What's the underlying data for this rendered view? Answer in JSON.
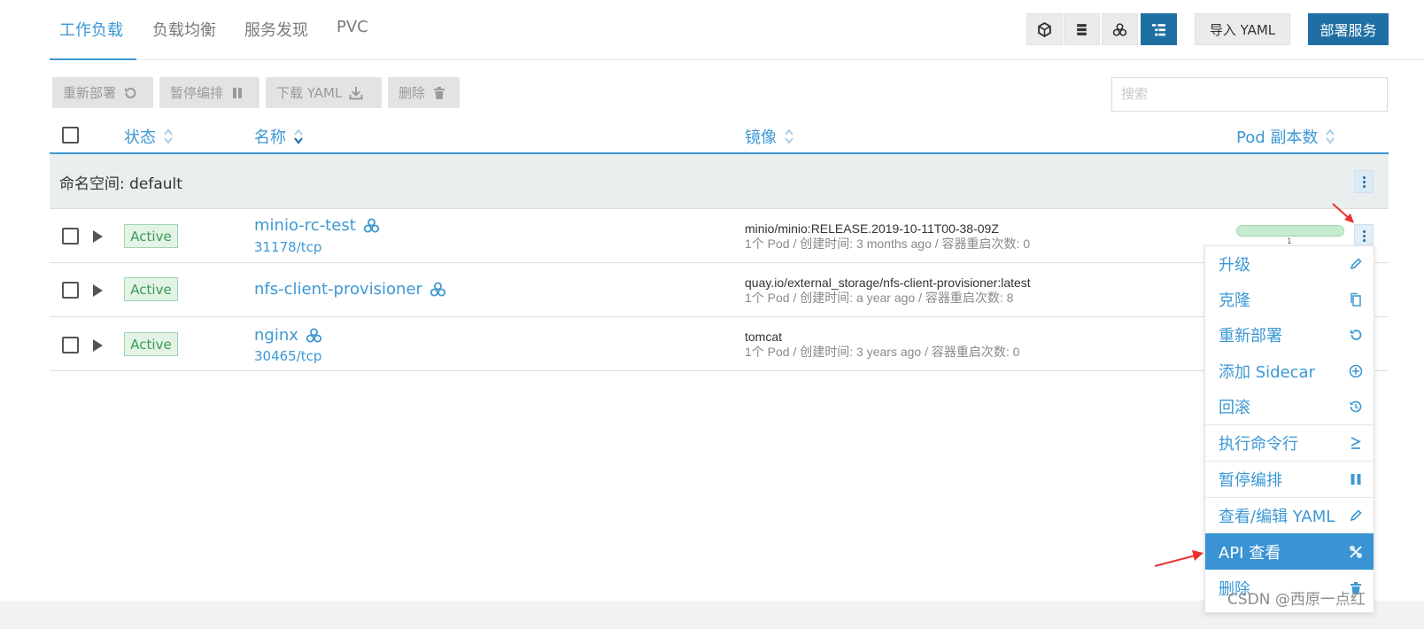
{
  "tabs": [
    "工作负载",
    "负载均衡",
    "服务发现",
    "PVC"
  ],
  "active_tab": 0,
  "header": {
    "import_label": "导入 YAML",
    "deploy_label": "部署服务"
  },
  "actions": {
    "redeploy": "重新部署",
    "pause": "暂停编排",
    "download": "下载 YAML",
    "delete": "删除"
  },
  "search": {
    "placeholder": "搜索"
  },
  "columns": {
    "state": "状态",
    "name": "名称",
    "image": "镜像",
    "pods": "Pod 副本数"
  },
  "group": {
    "label": "命名空间: default"
  },
  "rows": [
    {
      "status": "Active",
      "name": "minio-rc-test",
      "port": "31178/tcp",
      "image": "minio/minio:RELEASE.2019-10-11T00-38-09Z",
      "meta": "1个 Pod / 创建时间: 3 months ago / 容器重启次数: 0",
      "pods": "1"
    },
    {
      "status": "Active",
      "name": "nfs-client-provisioner",
      "port": "",
      "image": "quay.io/external_storage/nfs-client-provisioner:latest",
      "meta": "1个 Pod / 创建时间: a year ago / 容器重启次数: 8"
    },
    {
      "status": "Active",
      "name": "nginx",
      "port": "30465/tcp",
      "image": "tomcat",
      "meta": "1个 Pod / 创建时间: 3 years ago / 容器重启次数: 0"
    }
  ],
  "pod_ratio": 1.0,
  "menu": {
    "items": [
      {
        "label": "升级",
        "icon": "pencil-icon"
      },
      {
        "label": "克隆",
        "icon": "copy-icon"
      },
      {
        "label": "重新部署",
        "icon": "redeploy-icon"
      },
      {
        "label": "添加 Sidecar",
        "icon": "add-circle-icon"
      },
      {
        "label": "回滚",
        "icon": "history-icon"
      },
      {
        "label": "执行命令行",
        "icon": "terminal-icon"
      },
      {
        "label": "暂停编排",
        "icon": "pause-icon"
      },
      {
        "label": "查看/编辑 YAML",
        "icon": "pencil-icon"
      },
      {
        "label": "API 查看",
        "icon": "api-tools-icon"
      },
      {
        "label": "删除",
        "icon": "trash-icon"
      }
    ],
    "highlighted": "API 查看"
  },
  "watermark": "CSDN @西原一点红",
  "colors": {
    "accent": "#3d98d3",
    "primary": "#1f6fa5",
    "active_green": "#3a9b55",
    "arrow_red": "#e8322f"
  }
}
